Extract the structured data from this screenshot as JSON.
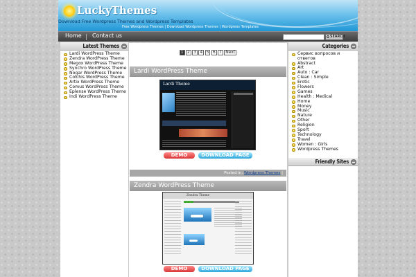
{
  "header": {
    "logo": "LuckyThemes",
    "tagline": "Download Free Wordpress Themes and Wordpress Templates",
    "subtagline": "Free Wordpress Themes | Download Wordpress Themes | Wordpress Templates"
  },
  "nav": {
    "items": [
      {
        "label": "Home"
      },
      {
        "label": "Contact us"
      }
    ],
    "search_button": "SEARCH",
    "search_value": ""
  },
  "left_sidebar": {
    "title": "Latest Themes",
    "items": [
      "Lardi WordPress Theme",
      "Zendra WordPress Theme",
      "Megox WordPress Theme",
      "Synchro WordPress Theme",
      "Nogar WordPress Theme",
      "Colchis WordPress Theme",
      "Artix WordPress Theme",
      "Comus WordPress Theme",
      "Eplense WordPress Theme",
      "Indi WordPress Theme"
    ]
  },
  "pagination": {
    "pages": [
      "1",
      "2",
      "3",
      "4",
      "5",
      "6",
      "7"
    ],
    "current": "1",
    "next": "Next"
  },
  "posts": [
    {
      "title": "Lardi WordPress Theme",
      "preview_logo": "Lardi Theme",
      "demo_label": "DEMO",
      "download_label": "DOWNLOAD PAGE",
      "posted_prefix": "Posted in:",
      "posted_category": "Wordpress Themes",
      "posted_suffix": "|"
    },
    {
      "title": "Zendra WordPress Theme",
      "preview_logo": "Zendra Theme",
      "demo_label": "DEMO",
      "download_label": "DOWNLOAD PAGE"
    }
  ],
  "right_sidebar": {
    "categories_title": "Categories",
    "categories": [
      "Сервис вопросов и ответов",
      "Abstract",
      "Art",
      "Auto : Car",
      "Clean : Simple",
      "Erotic",
      "Flowers",
      "Games",
      "Health : Medical",
      "Home",
      "Money",
      "Music",
      "Nature",
      "Other",
      "Religion",
      "Sport",
      "Technology",
      "Travel",
      "Women : Girls",
      "Wordpress Themes"
    ],
    "friendly_title": "Friendly Sites"
  },
  "icons": {
    "bullet": "sun-bullet-icon",
    "logo": "sun-logo-icon",
    "search": "magnifier-icon",
    "toggle": "minus-toggle-icon"
  },
  "colors": {
    "header_sky": "#1f97d6",
    "nav_bar": "#3b3b3b",
    "post_head": "#a6a6a6",
    "demo_button": "#d83636",
    "download_button": "#2da6d9"
  }
}
